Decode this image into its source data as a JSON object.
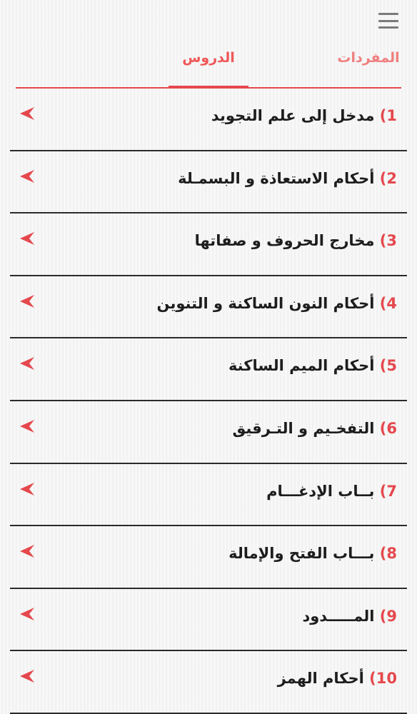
{
  "header": {
    "menu_icon": "hamburger-menu-icon"
  },
  "tabs": [
    {
      "id": "vocab",
      "label": "المفردات",
      "active": false
    },
    {
      "id": "lessons",
      "label": "الدروس",
      "active": true
    }
  ],
  "colors": {
    "accent": "#e5484d",
    "text": "#1d1d1d",
    "divider": "#2b2b2b",
    "background": "#f4f4f4"
  },
  "lessons": [
    {
      "number": "1)",
      "title": "مدخل إلى علم التجويد"
    },
    {
      "number": "2)",
      "title": "أحكام الاستعاذة و البسمـلة"
    },
    {
      "number": "3)",
      "title": "مخارج الحروف و صفاتها"
    },
    {
      "number": "4)",
      "title": "أحكام النون الساكنة و التنوين"
    },
    {
      "number": "5)",
      "title": "أحكام الميم الساكنة"
    },
    {
      "number": "6)",
      "title": "التفخـيم و التـرقيق"
    },
    {
      "number": "7)",
      "title": "بــاب الإدغـــام"
    },
    {
      "number": "8)",
      "title": "بـــاب الفتح والإمالة"
    },
    {
      "number": "9)",
      "title": "المـــــدود"
    },
    {
      "number": "10)",
      "title": "أحكام الهمز"
    }
  ],
  "item_icon": "play-arrow-left-icon"
}
